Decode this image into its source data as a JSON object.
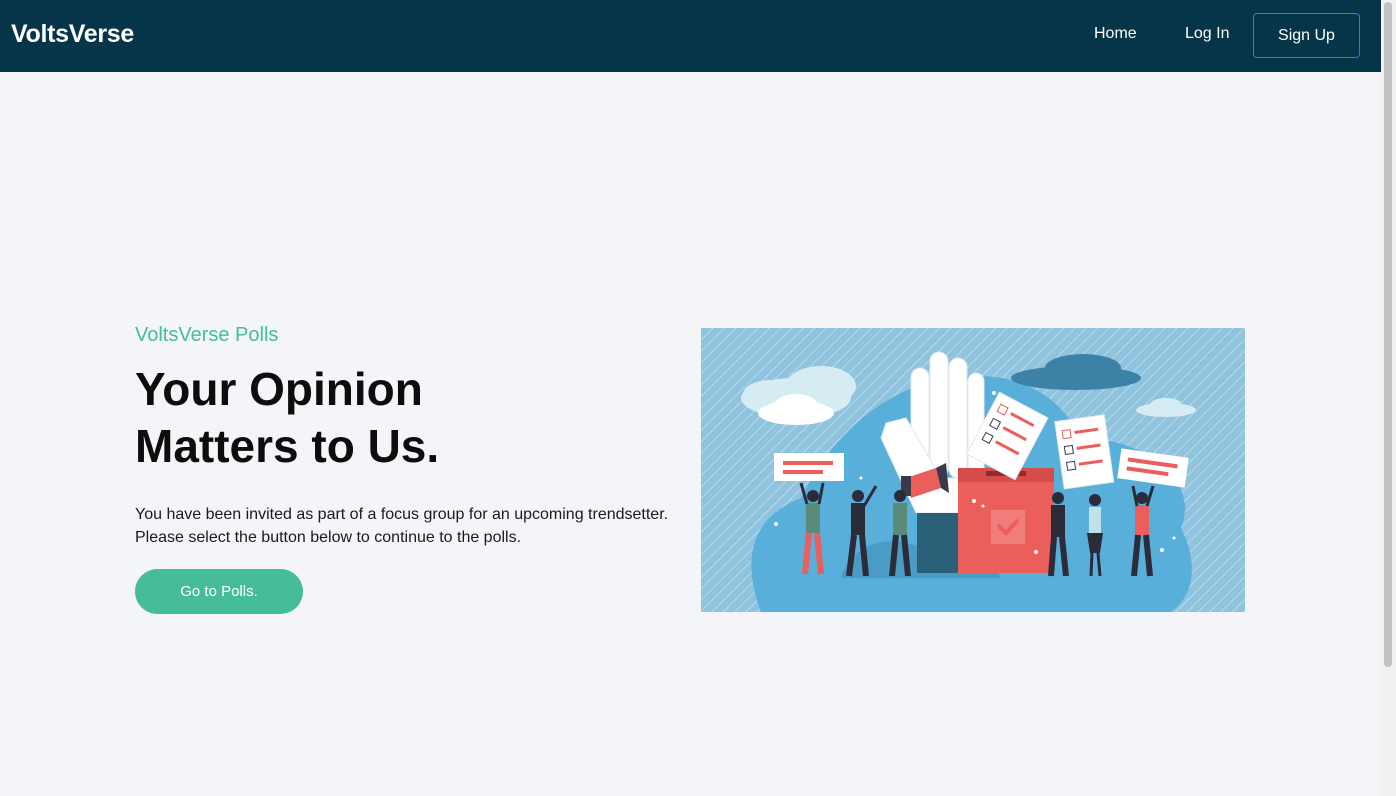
{
  "nav": {
    "brand": "VoltsVerse",
    "links": [
      {
        "label": "Home"
      },
      {
        "label": "Log In"
      }
    ],
    "signup_label": "Sign Up"
  },
  "hero": {
    "eyebrow": "VoltsVerse Polls",
    "headline_lines": [
      "Your Opinion",
      "Matters to Us."
    ],
    "description_lines": [
      "You have been invited as part of a focus group for an upcoming trendsetter.",
      "Please select the button below to continue to the polls."
    ],
    "cta_label": "Go to Polls."
  },
  "colors": {
    "navbar_bg": "#063448",
    "accent": "#47bc9b",
    "signup_border": "#2f7bf0",
    "page_bg": "#f4f5f9",
    "illustration_bg": "#8fc3de",
    "ballot_red": "#ea5e5b"
  },
  "illustration": {
    "subject": "people-voting-ballot-box"
  }
}
